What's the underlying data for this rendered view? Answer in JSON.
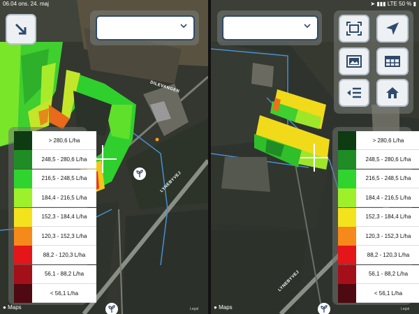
{
  "status_bar": {
    "time": "06.04",
    "date": "ons. 24. maj",
    "network": "LTE",
    "battery": "50 %"
  },
  "left_pane": {
    "dropdown_value": "",
    "road_label_1": "DILEVANGEN",
    "road_label_2": "LYNEBYVEJ"
  },
  "right_pane": {
    "dropdown_value": "",
    "road_label_1": "LYNEBYVEJ"
  },
  "legend": {
    "unit": "L/ha",
    "items": [
      {
        "label": "> 280,6 L/ha",
        "color": "#0e3b12"
      },
      {
        "label": "248,5 - 280,6 L/ha",
        "color": "#1f8c26"
      },
      {
        "label": "216,5 - 248,5 L/ha",
        "color": "#2fd42f"
      },
      {
        "label": "184,4 - 216,5 L/ha",
        "color": "#9ef02a"
      },
      {
        "label": "152,3 - 184,4 L/ha",
        "color": "#f4e21c"
      },
      {
        "label": "120,3 - 152,3 L/ha",
        "color": "#f58a1a"
      },
      {
        "label": "88,2 - 120,3 L/ha",
        "color": "#e4161a"
      },
      {
        "label": "56,1 - 88,2 L/ha",
        "color": "#a4101a"
      },
      {
        "label": "< 56,1 L/ha",
        "color": "#4e0a10"
      }
    ]
  },
  "attribution": {
    "maps": "Maps",
    "legal": "Legal"
  },
  "icons": {
    "collapse": "arrow-down-right-icon",
    "dropdown": "chevron-down-icon",
    "fit": "fit-screen-icon",
    "locate": "navigation-arrow-icon",
    "image": "image-layer-icon",
    "table": "table-icon",
    "list": "list-menu-icon",
    "home": "home-icon",
    "pin": "sprout-icon"
  }
}
